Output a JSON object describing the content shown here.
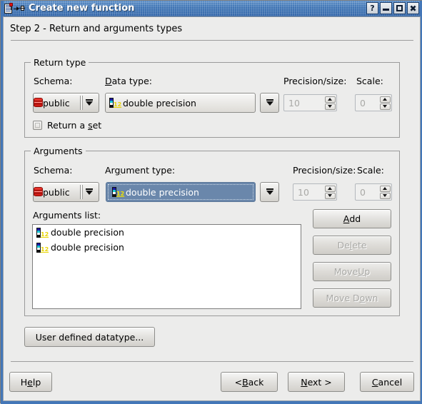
{
  "window": {
    "title": "Create new function",
    "icon": "function-pin-icon",
    "controls": [
      {
        "name": "help",
        "label": "?"
      },
      {
        "name": "minimize",
        "label": "—"
      },
      {
        "name": "maximize",
        "label": "□"
      },
      {
        "name": "close",
        "label": "✕"
      }
    ],
    "accent_color": "#3e74b4",
    "face_color": "#ececeb"
  },
  "header": {
    "step_text": "Step 2 - Return and arguments types"
  },
  "return_type": {
    "group_label": "Return type",
    "schema_label": "Schema:",
    "schema_value": "public",
    "schema_icon": "database-icon",
    "datatype_label_pre": "",
    "datatype_label_mnemonic": "D",
    "datatype_label_post": "ata type:",
    "datatype_value": "double precision",
    "datatype_icon": "datatype-icon",
    "precision_label": "Precision/size:",
    "precision_value": "10",
    "scale_label": "Scale:",
    "scale_value": "0",
    "return_set_pre": "Return a ",
    "return_set_mnemonic": "s",
    "return_set_post": "et",
    "return_set_checked": false
  },
  "arguments": {
    "group_label": "Arguments",
    "schema_label": "Schema:",
    "schema_value": "public",
    "schema_icon": "database-icon",
    "argtype_label_pre": "Ar",
    "argtype_label_mnemonic": "g",
    "argtype_label_post": "ument type:",
    "argtype_value": "double precision",
    "argtype_icon": "datatype-icon",
    "argtype_selected": true,
    "selection_color": "#6a87ab",
    "precision_label": "Precision/size:",
    "precision_value": "10",
    "scale_label": "Scale:",
    "scale_value": "0",
    "list_label": "Arguments list:",
    "list_items": [
      {
        "icon": "datatype-icon",
        "text": "double precision"
      },
      {
        "icon": "datatype-icon",
        "text": "double precision"
      }
    ],
    "buttons": [
      {
        "name": "add",
        "pre": "",
        "mnemonic": "A",
        "post": "dd",
        "enabled": true
      },
      {
        "name": "delete",
        "pre": "De",
        "mnemonic": "l",
        "post": "ete",
        "enabled": false
      },
      {
        "name": "move-up",
        "pre": "Move ",
        "mnemonic": "U",
        "post": "p",
        "enabled": false
      },
      {
        "name": "move-down",
        "pre": "Move D",
        "mnemonic": "o",
        "post": "wn",
        "enabled": false
      }
    ]
  },
  "user_defined": {
    "label": "User defined datatype...",
    "enabled": true
  },
  "footer": {
    "help": {
      "pre": "H",
      "mnemonic": "e",
      "post": "lp"
    },
    "back": {
      "pre": "< ",
      "mnemonic": "B",
      "post": "ack"
    },
    "next": {
      "pre": "N",
      "mnemonic": "e",
      "post": "xt >"
    },
    "cancel": {
      "pre": "",
      "mnemonic": "C",
      "post": "ancel"
    }
  }
}
